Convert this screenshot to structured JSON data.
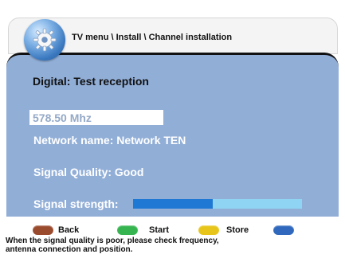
{
  "header": {
    "breadcrumb": "TV menu \\ Install \\ Channel installation"
  },
  "panel": {
    "title": "Digital: Test reception",
    "frequency": "578.50 Mhz",
    "network": "Network name: Network TEN",
    "quality": "Signal Quality: Good",
    "strength_label": "Signal strength:",
    "strength_level": 0.47
  },
  "footer": {
    "keys": [
      {
        "label": "Back",
        "color": "#9a4a2d"
      },
      {
        "label": "Start",
        "color": "#35b44f"
      },
      {
        "label": "Store",
        "color": "#e7c51a"
      },
      {
        "label": "",
        "color": "#2f68bd"
      }
    ],
    "help": "When the signal quality is poor, please check frequency, antenna connection and position."
  },
  "icons": {
    "logo": "gear-icon"
  },
  "colors": {
    "panel": "#91aed7",
    "signal_fill": "#1f78d3",
    "signal_track": "#8fd5f3"
  }
}
